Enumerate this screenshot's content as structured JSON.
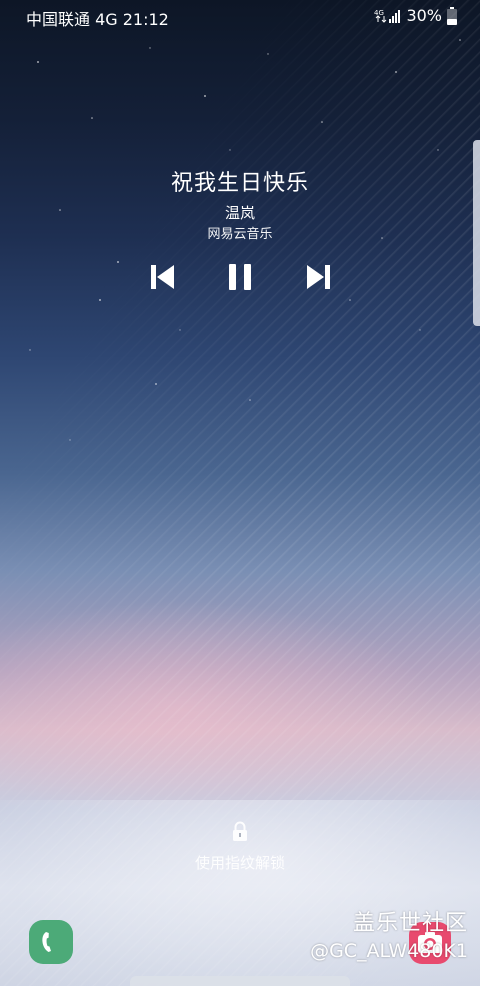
{
  "status_bar": {
    "carrier": "中国联通 4G 21:12",
    "network_badge": "4G",
    "battery": "30%"
  },
  "music": {
    "title": "祝我生日快乐",
    "artist": "温岚",
    "app": "网易云音乐",
    "icons": {
      "prev": "skip-previous-icon",
      "pause": "pause-icon",
      "next": "skip-next-icon"
    }
  },
  "lock": {
    "hint": "使用指纹解锁",
    "icon": "lock-icon"
  },
  "shortcuts": {
    "left": "phone-icon",
    "right": "camera-icon"
  },
  "watermark": {
    "brand": "盖乐世社区",
    "user": "@GC_ALW480K1"
  },
  "colors": {
    "phone_shortcut": "#4caa78",
    "camera_shortcut": "#e84a6e"
  }
}
